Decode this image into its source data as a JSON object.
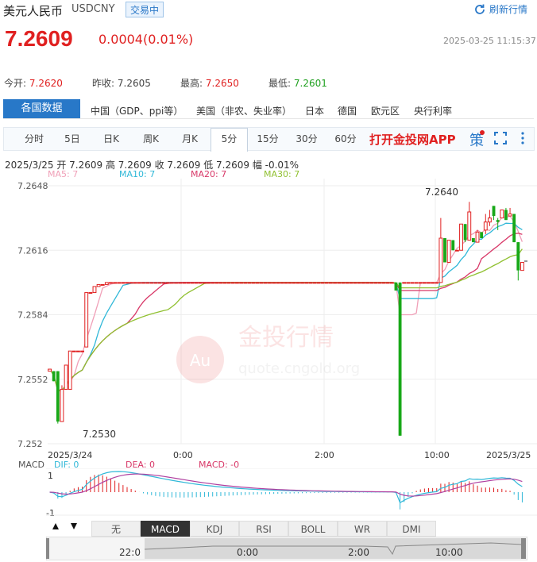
{
  "header": {
    "name": "美元人民币",
    "code": "USDCNY",
    "status": "交易中",
    "refresh_label": "刷新行情",
    "price": "7.2609",
    "change": "0.0004(0.01%)",
    "timestamp": "2025-03-25 11:15:37"
  },
  "stats": {
    "open_label": "今开:",
    "open": "7.2620",
    "prev_label": "昨收:",
    "prev": "7.2605",
    "high_label": "最高:",
    "high": "7.2650",
    "low_label": "最低:",
    "low": "7.2601"
  },
  "country_tabs": {
    "active": "各国数据",
    "items": [
      "中国（GDP、ppi等）",
      "美国（非农、失业率）",
      "日本",
      "德国",
      "欧元区",
      "央行利率"
    ]
  },
  "period_tabs": {
    "items": [
      "分时",
      "5日",
      "日K",
      "周K",
      "月K",
      "5分",
      "15分",
      "30分",
      "60分"
    ],
    "active": "5分",
    "app_promo": "打开金投网APP",
    "policy_label": "策"
  },
  "ohlc": "2025/3/25  开 7.2609  高 7.2609  收 7.2609  低 7.2609  幅 -0.01%",
  "ma_labels": {
    "ma5": "MA5: 7",
    "ma10": "MA10: 7",
    "ma20": "MA20: 7",
    "ma30": "MA30: 7"
  },
  "colors": {
    "up": "#e02020",
    "down": "#18a818",
    "ma5": "#f0a0b8",
    "ma10": "#30b8d8",
    "ma20": "#d83868",
    "ma30": "#90c030",
    "accent": "#2878c8"
  },
  "watermark": {
    "cn": "金投行情",
    "url": "quote.cngold.org",
    "logo": "Au"
  },
  "macd": {
    "label": "MACD",
    "dif": "DIF: 0",
    "dea": "DEA: 0",
    "macd": "MACD: -0",
    "ytop": "1",
    "ybottom": "-1"
  },
  "indicator_tabs": {
    "items": [
      "无",
      "MACD",
      "KDJ",
      "RSI",
      "BOLL",
      "WR",
      "DMI"
    ],
    "active": "MACD"
  },
  "navigator": {
    "labels": [
      "22:0",
      "0:00",
      "2:00",
      "10:00"
    ]
  },
  "chart_data": {
    "type": "candlestick",
    "y_ticks": [
      "7.2648",
      "7.2616",
      "7.2584",
      "7.2552",
      "7.252"
    ],
    "ylim": [
      7.252,
      7.2648
    ],
    "x_ticks": [
      "2025/3/24",
      "0:00",
      "2:00",
      "10:00",
      "2025/3/25"
    ],
    "annotations": {
      "max": "7.2640",
      "min": "7.2530"
    },
    "candles": [
      {
        "o": 7.2556,
        "c": 7.2557,
        "h": 7.2557,
        "l": 7.2556
      },
      {
        "o": 7.2556,
        "c": 7.2551,
        "h": 7.2556,
        "l": 7.2551
      },
      {
        "o": 7.2556,
        "c": 7.2531,
        "h": 7.2556,
        "l": 7.253
      },
      {
        "o": 7.2531,
        "c": 7.2547,
        "h": 7.2549,
        "l": 7.2531
      },
      {
        "o": 7.2547,
        "c": 7.2559,
        "h": 7.2559,
        "l": 7.2547
      },
      {
        "o": 7.2547,
        "c": 7.2566,
        "h": 7.2566,
        "l": 7.2547
      },
      {
        "o": 7.2566,
        "c": 7.2566,
        "h": 7.2566,
        "l": 7.2566
      },
      {
        "o": 7.2566,
        "c": 7.2566,
        "h": 7.2566,
        "l": 7.2566
      },
      {
        "o": 7.2566,
        "c": 7.2566,
        "h": 7.2566,
        "l": 7.2566
      },
      {
        "o": 7.2568,
        "c": 7.2595,
        "h": 7.2595,
        "l": 7.2568
      },
      {
        "o": 7.2595,
        "c": 7.2595,
        "h": 7.2595,
        "l": 7.2595
      },
      {
        "o": 7.2595,
        "c": 7.2598,
        "h": 7.2598,
        "l": 7.2595
      },
      {
        "o": 7.2598,
        "c": 7.2599,
        "h": 7.2599,
        "l": 7.2598
      },
      {
        "o": 7.2599,
        "c": 7.2599,
        "h": 7.2599,
        "l": 7.2599
      },
      {
        "o": 7.2599,
        "c": 7.26,
        "h": 7.26,
        "l": 7.2599
      },
      {
        "o": 7.26,
        "c": 7.26,
        "h": 7.26,
        "l": 7.26
      },
      {
        "o": 7.26,
        "c": 7.26,
        "h": 7.26,
        "l": 7.26
      },
      {
        "o": 7.26,
        "c": 7.26,
        "h": 7.26,
        "l": 7.26
      },
      {
        "o": 7.26,
        "c": 7.26,
        "h": 7.26,
        "l": 7.26
      },
      {
        "o": 7.26,
        "c": 7.26,
        "h": 7.26,
        "l": 7.26
      },
      {
        "o": 7.26,
        "c": 7.26,
        "h": 7.26,
        "l": 7.26
      },
      {
        "o": 7.26,
        "c": 7.26,
        "h": 7.26,
        "l": 7.26
      },
      {
        "o": 7.26,
        "c": 7.26,
        "h": 7.26,
        "l": 7.26
      },
      {
        "o": 7.26,
        "c": 7.26,
        "h": 7.26,
        "l": 7.26
      },
      {
        "o": 7.26,
        "c": 7.26,
        "h": 7.26,
        "l": 7.26
      },
      {
        "o": 7.26,
        "c": 7.26,
        "h": 7.26,
        "l": 7.26
      },
      {
        "o": 7.26,
        "c": 7.26,
        "h": 7.26,
        "l": 7.26
      },
      {
        "o": 7.26,
        "c": 7.26,
        "h": 7.26,
        "l": 7.26
      },
      {
        "o": 7.26,
        "c": 7.26,
        "h": 7.26,
        "l": 7.26
      },
      {
        "o": 7.26,
        "c": 7.26,
        "h": 7.26,
        "l": 7.26
      },
      {
        "o": 7.26,
        "c": 7.26,
        "h": 7.26,
        "l": 7.26
      },
      {
        "o": 7.26,
        "c": 7.26,
        "h": 7.26,
        "l": 7.26
      },
      {
        "o": 7.26,
        "c": 7.26,
        "h": 7.26,
        "l": 7.26
      },
      {
        "o": 7.26,
        "c": 7.26,
        "h": 7.26,
        "l": 7.26
      },
      {
        "o": 7.26,
        "c": 7.26,
        "h": 7.26,
        "l": 7.26
      },
      {
        "o": 7.26,
        "c": 7.26,
        "h": 7.26,
        "l": 7.26
      },
      {
        "o": 7.26,
        "c": 7.26,
        "h": 7.26,
        "l": 7.26
      },
      {
        "o": 7.26,
        "c": 7.26,
        "h": 7.26,
        "l": 7.26
      },
      {
        "o": 7.26,
        "c": 7.26,
        "h": 7.26,
        "l": 7.26
      },
      {
        "o": 7.26,
        "c": 7.26,
        "h": 7.26,
        "l": 7.26
      },
      {
        "o": 7.26,
        "c": 7.26,
        "h": 7.26,
        "l": 7.26
      },
      {
        "o": 7.26,
        "c": 7.26,
        "h": 7.26,
        "l": 7.26
      },
      {
        "o": 7.26,
        "c": 7.26,
        "h": 7.26,
        "l": 7.26
      },
      {
        "o": 7.26,
        "c": 7.26,
        "h": 7.26,
        "l": 7.26
      },
      {
        "o": 7.26,
        "c": 7.26,
        "h": 7.26,
        "l": 7.26
      },
      {
        "o": 7.26,
        "c": 7.26,
        "h": 7.26,
        "l": 7.26
      },
      {
        "o": 7.26,
        "c": 7.26,
        "h": 7.26,
        "l": 7.26
      },
      {
        "o": 7.26,
        "c": 7.26,
        "h": 7.26,
        "l": 7.26
      },
      {
        "o": 7.26,
        "c": 7.26,
        "h": 7.26,
        "l": 7.26
      },
      {
        "o": 7.26,
        "c": 7.26,
        "h": 7.26,
        "l": 7.26
      },
      {
        "o": 7.26,
        "c": 7.26,
        "h": 7.26,
        "l": 7.26
      },
      {
        "o": 7.26,
        "c": 7.26,
        "h": 7.26,
        "l": 7.26
      },
      {
        "o": 7.26,
        "c": 7.26,
        "h": 7.26,
        "l": 7.26
      },
      {
        "o": 7.26,
        "c": 7.26,
        "h": 7.26,
        "l": 7.26
      },
      {
        "o": 7.26,
        "c": 7.26,
        "h": 7.26,
        "l": 7.26
      },
      {
        "o": 7.26,
        "c": 7.26,
        "h": 7.26,
        "l": 7.26
      },
      {
        "o": 7.26,
        "c": 7.26,
        "h": 7.26,
        "l": 7.26
      },
      {
        "o": 7.26,
        "c": 7.26,
        "h": 7.26,
        "l": 7.26
      },
      {
        "o": 7.26,
        "c": 7.26,
        "h": 7.26,
        "l": 7.26
      },
      {
        "o": 7.26,
        "c": 7.26,
        "h": 7.26,
        "l": 7.26
      },
      {
        "o": 7.26,
        "c": 7.26,
        "h": 7.26,
        "l": 7.26
      },
      {
        "o": 7.26,
        "c": 7.26,
        "h": 7.26,
        "l": 7.26
      },
      {
        "o": 7.26,
        "c": 7.26,
        "h": 7.26,
        "l": 7.26
      },
      {
        "o": 7.26,
        "c": 7.26,
        "h": 7.26,
        "l": 7.26
      },
      {
        "o": 7.26,
        "c": 7.26,
        "h": 7.26,
        "l": 7.26
      },
      {
        "o": 7.26,
        "c": 7.26,
        "h": 7.26,
        "l": 7.26
      },
      {
        "o": 7.26,
        "c": 7.26,
        "h": 7.26,
        "l": 7.26
      },
      {
        "o": 7.26,
        "c": 7.26,
        "h": 7.26,
        "l": 7.26
      },
      {
        "o": 7.26,
        "c": 7.26,
        "h": 7.26,
        "l": 7.26
      },
      {
        "o": 7.26,
        "c": 7.26,
        "h": 7.26,
        "l": 7.26
      },
      {
        "o": 7.26,
        "c": 7.26,
        "h": 7.26,
        "l": 7.26
      },
      {
        "o": 7.26,
        "c": 7.26,
        "h": 7.26,
        "l": 7.26
      },
      {
        "o": 7.26,
        "c": 7.26,
        "h": 7.26,
        "l": 7.26
      },
      {
        "o": 7.26,
        "c": 7.26,
        "h": 7.26,
        "l": 7.26
      },
      {
        "o": 7.26,
        "c": 7.26,
        "h": 7.26,
        "l": 7.26
      },
      {
        "o": 7.26,
        "c": 7.26,
        "h": 7.26,
        "l": 7.26
      },
      {
        "o": 7.26,
        "c": 7.26,
        "h": 7.26,
        "l": 7.26
      },
      {
        "o": 7.26,
        "c": 7.26,
        "h": 7.26,
        "l": 7.26
      },
      {
        "o": 7.26,
        "c": 7.26,
        "h": 7.26,
        "l": 7.26
      },
      {
        "o": 7.26,
        "c": 7.26,
        "h": 7.26,
        "l": 7.26
      },
      {
        "o": 7.26,
        "c": 7.26,
        "h": 7.26,
        "l": 7.26
      },
      {
        "o": 7.26,
        "c": 7.26,
        "h": 7.26,
        "l": 7.26
      },
      {
        "o": 7.26,
        "c": 7.26,
        "h": 7.26,
        "l": 7.26
      },
      {
        "o": 7.26,
        "c": 7.26,
        "h": 7.26,
        "l": 7.26
      },
      {
        "o": 7.26,
        "c": 7.26,
        "h": 7.26,
        "l": 7.26
      },
      {
        "o": 7.26,
        "c": 7.2596,
        "h": 7.26,
        "l": 7.2596
      },
      {
        "o": 7.26,
        "c": 7.2524,
        "h": 7.26,
        "l": 7.2524
      },
      {
        "o": 7.26,
        "c": 7.26,
        "h": 7.26,
        "l": 7.26
      },
      {
        "o": 7.26,
        "c": 7.26,
        "h": 7.26,
        "l": 7.26
      },
      {
        "o": 7.26,
        "c": 7.26,
        "h": 7.26,
        "l": 7.26
      },
      {
        "o": 7.26,
        "c": 7.26,
        "h": 7.26,
        "l": 7.26
      },
      {
        "o": 7.26,
        "c": 7.26,
        "h": 7.26,
        "l": 7.26
      },
      {
        "o": 7.26,
        "c": 7.26,
        "h": 7.26,
        "l": 7.26
      },
      {
        "o": 7.26,
        "c": 7.26,
        "h": 7.26,
        "l": 7.26
      },
      {
        "o": 7.26,
        "c": 7.26,
        "h": 7.26,
        "l": 7.26
      },
      {
        "o": 7.26,
        "c": 7.26,
        "h": 7.26,
        "l": 7.26
      },
      {
        "o": 7.26,
        "c": 7.2622,
        "h": 7.2632,
        "l": 7.26
      },
      {
        "o": 7.2622,
        "c": 7.261,
        "h": 7.2622,
        "l": 7.261
      },
      {
        "o": 7.261,
        "c": 7.2621,
        "h": 7.2621,
        "l": 7.261
      },
      {
        "o": 7.2621,
        "c": 7.2616,
        "h": 7.2621,
        "l": 7.2616
      },
      {
        "o": 7.2616,
        "c": 7.2616,
        "h": 7.2616,
        "l": 7.2616
      },
      {
        "o": 7.2616,
        "c": 7.2629,
        "h": 7.2629,
        "l": 7.2616
      },
      {
        "o": 7.2629,
        "c": 7.2621,
        "h": 7.2629,
        "l": 7.262
      },
      {
        "o": 7.2621,
        "c": 7.2635,
        "h": 7.264,
        "l": 7.2621
      },
      {
        "o": 7.2622,
        "c": 7.262,
        "h": 7.2622,
        "l": 7.262
      },
      {
        "o": 7.262,
        "c": 7.2625,
        "h": 7.2626,
        "l": 7.262
      },
      {
        "o": 7.2625,
        "c": 7.2622,
        "h": 7.2625,
        "l": 7.2622
      },
      {
        "o": 7.2626,
        "c": 7.263,
        "h": 7.2634,
        "l": 7.2624
      },
      {
        "o": 7.263,
        "c": 7.2632,
        "h": 7.2636,
        "l": 7.2628
      },
      {
        "o": 7.2638,
        "c": 7.2633,
        "h": 7.2638,
        "l": 7.2631
      },
      {
        "o": 7.2631,
        "c": 7.263,
        "h": 7.2632,
        "l": 7.2626
      },
      {
        "o": 7.2632,
        "c": 7.2636,
        "h": 7.2636,
        "l": 7.2632
      },
      {
        "o": 7.2636,
        "c": 7.2631,
        "h": 7.2637,
        "l": 7.2631
      },
      {
        "o": 7.2633,
        "c": 7.2634,
        "h": 7.2637,
        "l": 7.2633
      },
      {
        "o": 7.2634,
        "c": 7.262,
        "h": 7.2634,
        "l": 7.262
      },
      {
        "o": 7.262,
        "c": 7.2606,
        "h": 7.262,
        "l": 7.2601
      },
      {
        "o": 7.2606,
        "c": 7.261,
        "h": 7.261,
        "l": 7.2606
      }
    ]
  }
}
